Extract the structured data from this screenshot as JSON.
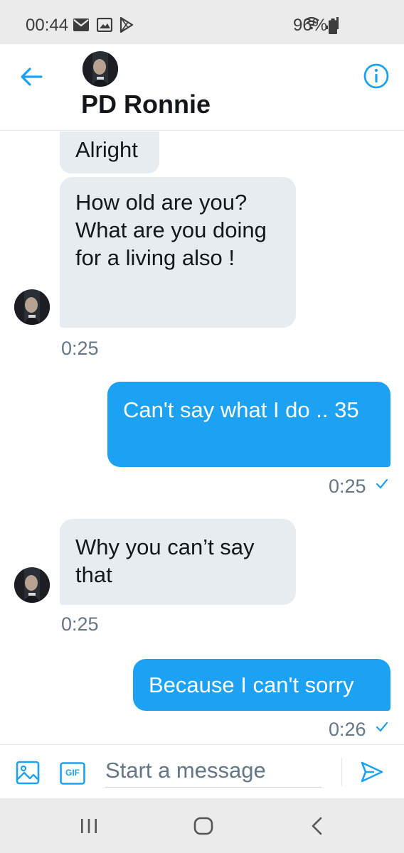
{
  "status_bar": {
    "time": "00:44",
    "battery": "96%",
    "left_icons": [
      "mail-icon",
      "gallery-icon",
      "play-store-icon"
    ],
    "right_icons": [
      "wifi-icon",
      "signal-icon",
      "battery-icon"
    ]
  },
  "header": {
    "contact_name": "PD Ronnie",
    "back_icon": "back-arrow-icon",
    "info_icon": "info-icon"
  },
  "messages": [
    {
      "direction": "incoming",
      "text": "Alright"
    },
    {
      "direction": "incoming",
      "text": "How old are you? What are you doing for a living also !",
      "time": "0:25"
    },
    {
      "direction": "outgoing",
      "text": "Can't say what I do .. 35",
      "time": "0:25",
      "status": "sent"
    },
    {
      "direction": "incoming",
      "text": "Why you can’t say that",
      "time": "0:25"
    },
    {
      "direction": "outgoing",
      "text": "Because I can't sorry",
      "time": "0:26",
      "status": "sent"
    }
  ],
  "compose": {
    "placeholder": "Start a message",
    "gif_label": "GIF",
    "icons": [
      "image-icon",
      "gif-icon",
      "send-icon"
    ]
  },
  "nav_bar": {
    "icons": [
      "recents-icon",
      "home-icon",
      "back-icon"
    ]
  },
  "colors": {
    "accent": "#1da1f2",
    "incoming_bubble": "#e6ecf0",
    "text_secondary": "#657786",
    "system_bar": "#ebebeb"
  }
}
